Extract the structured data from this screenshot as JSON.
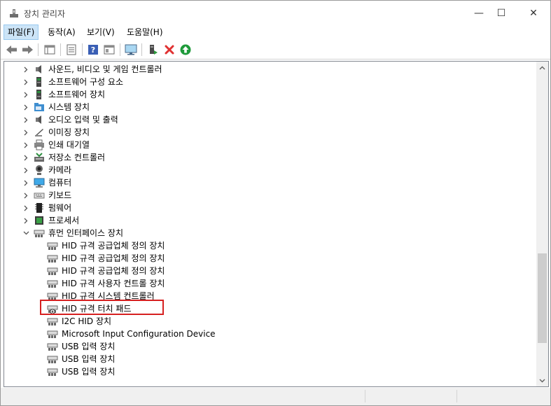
{
  "window": {
    "title": "장치 관리자",
    "minimize": "—",
    "maximize": "☐",
    "close": "✕"
  },
  "menu": [
    "파일(F)",
    "동작(A)",
    "보기(V)",
    "도움말(H)"
  ],
  "toolbar": [
    "back",
    "forward",
    "properties-view",
    "properties",
    "help",
    "view",
    "monitor",
    "update-driver",
    "uninstall",
    "scan"
  ],
  "tree": [
    {
      "label": "사운드, 비디오 및 게임 컨트롤러",
      "expander": "collapsed",
      "icon": "speaker-icon",
      "level": 1
    },
    {
      "label": "소프트웨어 구성 요소",
      "expander": "collapsed",
      "icon": "software-component-icon",
      "level": 1
    },
    {
      "label": "소프트웨어 장치",
      "expander": "collapsed",
      "icon": "software-device-icon",
      "level": 1
    },
    {
      "label": "시스템 장치",
      "expander": "collapsed",
      "icon": "system-folder-icon",
      "level": 1
    },
    {
      "label": "오디오 입력 및 출력",
      "expander": "collapsed",
      "icon": "speaker-icon",
      "level": 1
    },
    {
      "label": "이미징 장치",
      "expander": "collapsed",
      "icon": "imaging-icon",
      "level": 1
    },
    {
      "label": "인쇄 대기열",
      "expander": "collapsed",
      "icon": "printer-icon",
      "level": 1
    },
    {
      "label": "저장소 컨트롤러",
      "expander": "collapsed",
      "icon": "storage-controller-icon",
      "level": 1
    },
    {
      "label": "카메라",
      "expander": "collapsed",
      "icon": "camera-icon",
      "level": 1
    },
    {
      "label": "컴퓨터",
      "expander": "collapsed",
      "icon": "computer-icon",
      "level": 1
    },
    {
      "label": "키보드",
      "expander": "collapsed",
      "icon": "keyboard-icon",
      "level": 1
    },
    {
      "label": "펌웨어",
      "expander": "collapsed",
      "icon": "firmware-icon",
      "level": 1
    },
    {
      "label": "프로세서",
      "expander": "collapsed",
      "icon": "processor-icon",
      "level": 1
    },
    {
      "label": "휴먼 인터페이스 장치",
      "expander": "expanded",
      "icon": "hid-icon",
      "level": 1
    },
    {
      "label": "HID 규격 공급업체 정의 장치",
      "expander": "",
      "icon": "hid-icon",
      "level": 2
    },
    {
      "label": "HID 규격 공급업체 정의 장치",
      "expander": "",
      "icon": "hid-icon",
      "level": 2
    },
    {
      "label": "HID 규격 공급업체 정의 장치",
      "expander": "",
      "icon": "hid-icon",
      "level": 2
    },
    {
      "label": "HID 규격 사용자 컨트롤 장치",
      "expander": "",
      "icon": "hid-icon",
      "level": 2
    },
    {
      "label": "HID 규격 시스템 컨트롤러",
      "expander": "",
      "icon": "hid-icon",
      "level": 2
    },
    {
      "label": "HID 규격 터치 패드",
      "expander": "",
      "icon": "hid-disabled-icon",
      "level": 2
    },
    {
      "label": "I2C HID 장치",
      "expander": "",
      "icon": "hid-icon",
      "level": 2
    },
    {
      "label": "Microsoft Input Configuration Device",
      "expander": "",
      "icon": "hid-icon",
      "level": 2
    },
    {
      "label": "USB 입력 장치",
      "expander": "",
      "icon": "hid-icon",
      "level": 2
    },
    {
      "label": "USB 입력 장치",
      "expander": "",
      "icon": "hid-icon",
      "level": 2
    },
    {
      "label": "USB 입력 장치",
      "expander": "",
      "icon": "hid-icon",
      "level": 2
    }
  ],
  "scroll": {
    "position": 0.55,
    "visible_fraction": 0.69
  },
  "colors": {
    "highlight": "#d62020",
    "menu_active": "#cce4f7",
    "scan_green": "#1e9a3a",
    "uninstall_red": "#e03131"
  }
}
